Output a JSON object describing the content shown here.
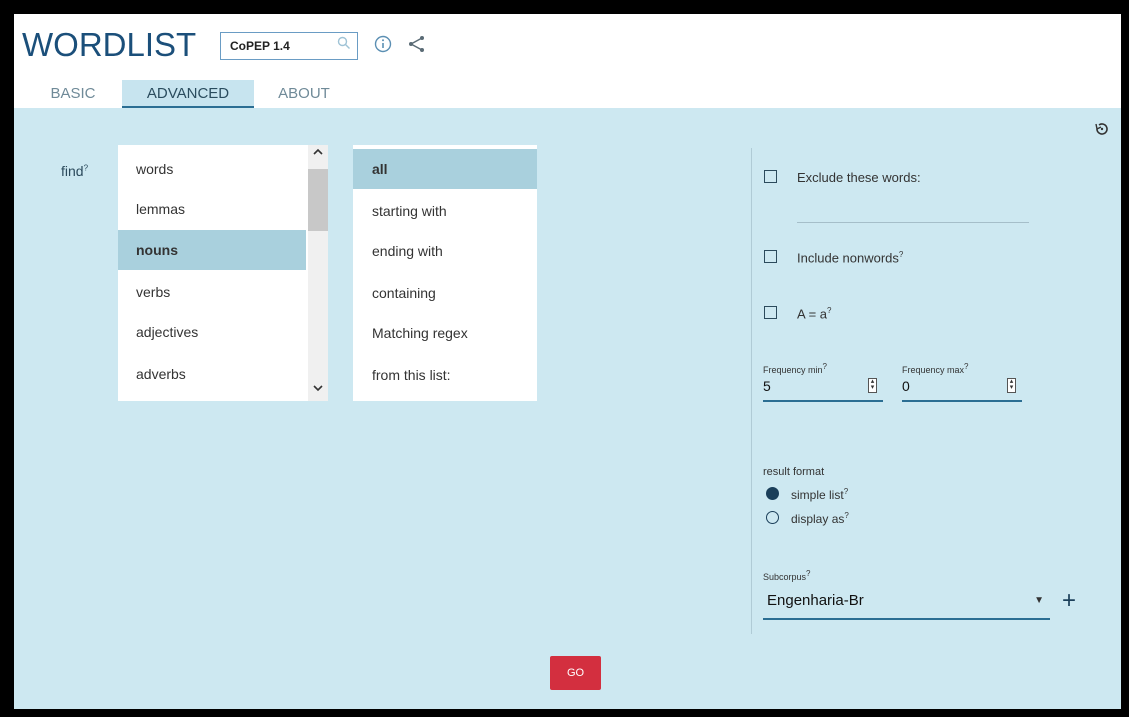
{
  "header": {
    "app_title": "WORDLIST",
    "corpus": "CoPEP 1.4"
  },
  "tabs": [
    {
      "label": "BASIC",
      "active": false
    },
    {
      "label": "ADVANCED",
      "active": true
    },
    {
      "label": "ABOUT",
      "active": false
    }
  ],
  "find": {
    "label": "find",
    "help": "?",
    "attributes": [
      "words",
      "lemmas",
      "nouns",
      "verbs",
      "adjectives",
      "adverbs"
    ],
    "selected_attribute": "nouns",
    "filters": [
      "all",
      "starting with",
      "ending with",
      "containing",
      "Matching regex",
      "from this list:"
    ],
    "selected_filter": "all"
  },
  "options": {
    "exclude_label": "Exclude these words:",
    "nonwords_label": "Include nonwords",
    "nonwords_help": "?",
    "case_label": "A = a",
    "case_help": "?"
  },
  "frequency": {
    "min_label": "Frequency min",
    "min_help": "?",
    "min_value": "5",
    "max_label": "Frequency max",
    "max_help": "?",
    "max_value": "0"
  },
  "result_format": {
    "title": "result format",
    "options": [
      {
        "label": "simple list",
        "help": "?",
        "selected": true
      },
      {
        "label": "display as",
        "help": "?",
        "selected": false
      }
    ]
  },
  "subcorpus": {
    "label": "Subcorpus",
    "help": "?",
    "value": "Engenharia-Br"
  },
  "go_label": "GO",
  "colors": {
    "panel_bg": "#cde8f1",
    "accent": "#2b6e93",
    "selected_item": "#a9d0dd",
    "go_button": "#d32f3f"
  },
  "icons": [
    "search-icon",
    "info-icon",
    "share-icon",
    "reset-icon",
    "plus-icon",
    "dropdown-arrow-icon"
  ]
}
